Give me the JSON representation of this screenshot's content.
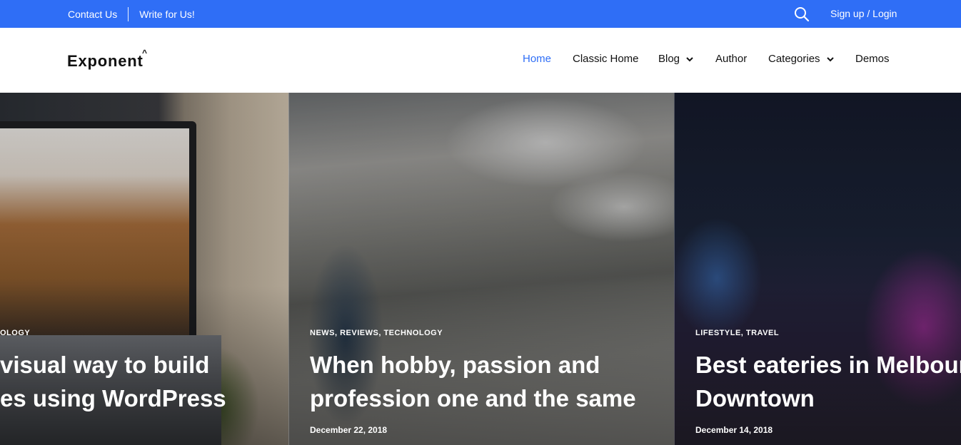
{
  "topbar": {
    "contact": "Contact Us",
    "write": "Write for Us!",
    "signup": "Sign up / Login",
    "icons": {
      "search": "search-icon"
    },
    "color": "#2f6ef6"
  },
  "header": {
    "logo": "Exponent",
    "nav": [
      {
        "label": "Home",
        "active": true
      },
      {
        "label": "Classic Home"
      },
      {
        "label": "Blog",
        "dropdown": true
      },
      {
        "label": "Author"
      },
      {
        "label": "Categories",
        "dropdown": true
      },
      {
        "label": "Demos"
      }
    ]
  },
  "posts": [
    {
      "categories": "OLOGY",
      "title_line1": "visual way to build",
      "title_line2": "es using WordPress",
      "date": "",
      "image": "laptop-photo"
    },
    {
      "categories": "NEWS, REVIEWS, TECHNOLOGY",
      "title_line1": "When hobby, passion and",
      "title_line2": "profession one and the same",
      "date": "December 22, 2018",
      "image": "mountain-hiker-photo"
    },
    {
      "categories": "LIFESTYLE, TRAVEL",
      "title_line1": "Best eateries in Melbour",
      "title_line2": "Downtown",
      "date": "December 14, 2018",
      "image": "city-night-photo"
    }
  ]
}
